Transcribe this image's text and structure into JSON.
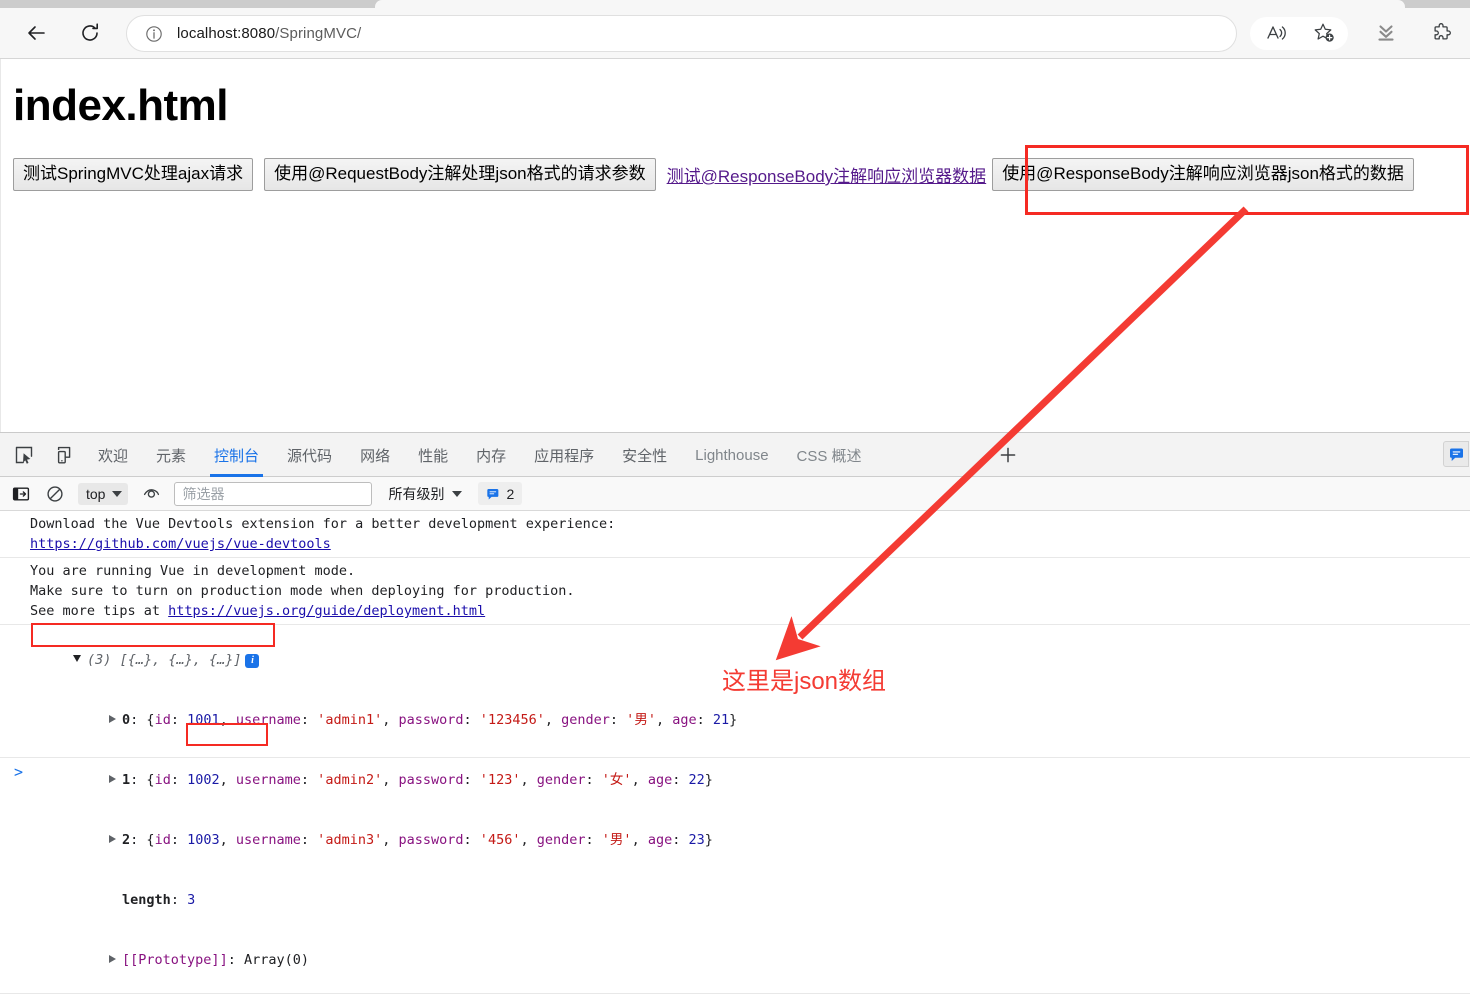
{
  "browser": {
    "url_host": "localhost:8080",
    "url_path": "/SpringMVC/",
    "icons": {
      "back": "back-arrow-icon",
      "reload": "reload-icon",
      "info": "info-icon",
      "read_aloud": "read-aloud-icon",
      "favorite": "add-favorite-icon",
      "downloads": "downloads-icon",
      "extensions": "extensions-icon"
    }
  },
  "page": {
    "title": "index.html",
    "buttons": [
      {
        "label": "测试SpringMVC处理ajax请求"
      },
      {
        "label": "使用@RequestBody注解处理json格式的请求参数"
      }
    ],
    "link": {
      "label": "测试@ResponseBody注解响应浏览器数据"
    },
    "highlighted_button": {
      "label": "使用@ResponseBody注解响应浏览器json格式的数据"
    }
  },
  "annotation": {
    "text": "这里是json数组",
    "color": "#f43b33"
  },
  "devtools": {
    "left_icons": [
      {
        "name": "inspect-element-icon"
      },
      {
        "name": "device-toolbar-icon"
      }
    ],
    "tabs": [
      {
        "label": "欢迎",
        "active": false,
        "dim": false
      },
      {
        "label": "元素",
        "active": false,
        "dim": false
      },
      {
        "label": "控制台",
        "active": true,
        "dim": false
      },
      {
        "label": "源代码",
        "active": false,
        "dim": false
      },
      {
        "label": "网络",
        "active": false,
        "dim": false
      },
      {
        "label": "性能",
        "active": false,
        "dim": false
      },
      {
        "label": "内存",
        "active": false,
        "dim": false
      },
      {
        "label": "应用程序",
        "active": false,
        "dim": false
      },
      {
        "label": "安全性",
        "active": false,
        "dim": false
      },
      {
        "label": "Lighthouse",
        "active": false,
        "dim": true
      },
      {
        "label": "CSS 概述",
        "active": false,
        "dim": true
      }
    ],
    "add_tab_label": "+",
    "accent_color": "#1a73e8",
    "console_toolbar": {
      "context_value": "top",
      "filter_placeholder": "筛选器",
      "filter_value": "",
      "level_label": "所有级别",
      "message_count": "2",
      "icons": {
        "sidebar": "console-sidebar-icon",
        "clear": "clear-console-icon",
        "eye": "live-expression-icon",
        "message_badge": "message-badge-icon"
      }
    },
    "console_messages": [
      {
        "lines": [
          "Download the Vue Devtools extension for a better development experience:"
        ],
        "link": "https://github.com/vuejs/vue-devtools"
      },
      {
        "lines": [
          "You are running Vue in development mode.",
          "Make sure to turn on production mode when deploying for production.",
          "See more tips at "
        ],
        "link": "https://vuejs.org/guide/deployment.html"
      }
    ],
    "array_output": {
      "header_count": "(3)",
      "header_preview": "[{…}, {…}, {…}]",
      "items": [
        {
          "index": "0",
          "id": "1001",
          "username": "admin1",
          "password": "123456",
          "gender": "男",
          "age": "21"
        },
        {
          "index": "1",
          "id": "1002",
          "username": "admin2",
          "password": "123",
          "gender": "女",
          "age": "22"
        },
        {
          "index": "2",
          "id": "1003",
          "username": "admin3",
          "password": "456",
          "gender": "男",
          "age": "23"
        }
      ],
      "length_key": "length",
      "length_value": "3",
      "proto_key": "[[Prototype]]",
      "proto_value": "Array(0)",
      "keys": {
        "id": "id",
        "username": "username",
        "password": "password",
        "gender": "gender",
        "age": "age"
      }
    },
    "prompt_symbol": ">"
  }
}
